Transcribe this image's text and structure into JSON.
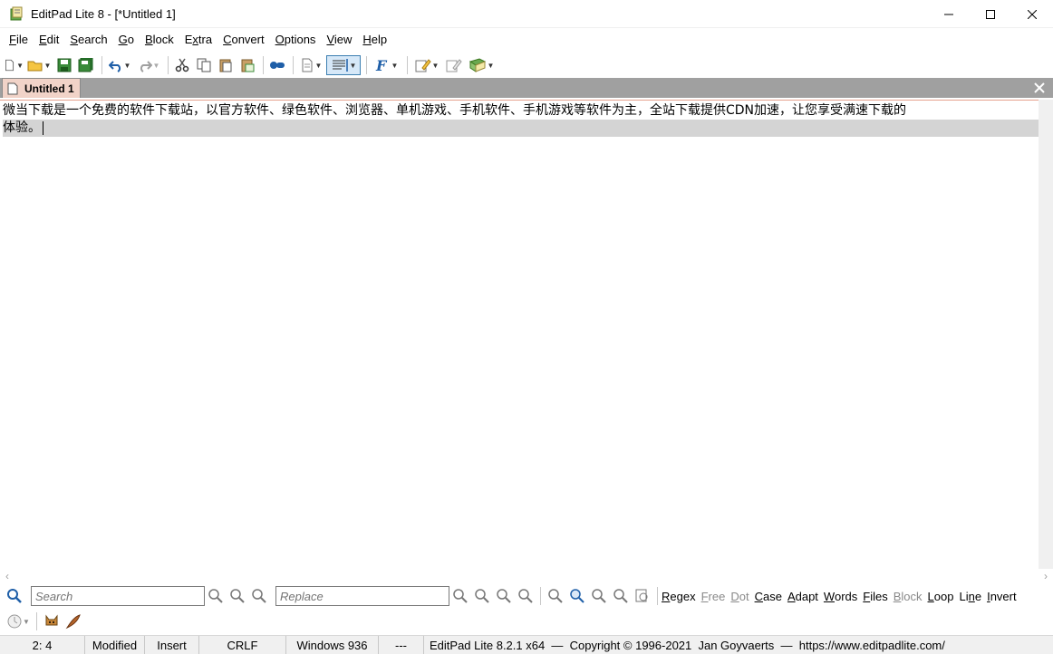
{
  "window": {
    "title": "EditPad Lite 8 - [*Untitled 1]",
    "controls": [
      "minimize",
      "maximize",
      "close"
    ]
  },
  "menu": {
    "items": [
      {
        "label": "File",
        "hotkey": "F"
      },
      {
        "label": "Edit",
        "hotkey": "E"
      },
      {
        "label": "Search",
        "hotkey": "S"
      },
      {
        "label": "Go",
        "hotkey": "G"
      },
      {
        "label": "Block",
        "hotkey": "B"
      },
      {
        "label": "Extra",
        "hotkey": "x"
      },
      {
        "label": "Convert",
        "hotkey": "C"
      },
      {
        "label": "Options",
        "hotkey": "O"
      },
      {
        "label": "View",
        "hotkey": "V"
      },
      {
        "label": "Help",
        "hotkey": "H"
      }
    ]
  },
  "toolbar": {
    "buttons": [
      "new-file-icon",
      "open-file-icon",
      "save-icon",
      "save-all-icon",
      "undo-icon",
      "redo-icon",
      "cut-icon",
      "copy-icon",
      "paste-icon",
      "paste-special-icon",
      "clipboard-icon",
      "print-icon",
      "word-wrap-icon",
      "font-icon",
      "edit-icon",
      "spellcheck-icon",
      "book-icon"
    ]
  },
  "tabs": {
    "items": [
      {
        "label": "Untitled 1",
        "active": true
      }
    ]
  },
  "editor": {
    "line1": "微当下载是一个免费的软件下载站，以官方软件、绿色软件、浏览器、单机游戏、手机软件、手机游戏等软件为主，全站下载提供CDN加速，让您享受满速下载的",
    "line2": "体验。"
  },
  "search": {
    "search_placeholder": "Search",
    "replace_placeholder": "Replace",
    "options": [
      {
        "label": "Regex",
        "hotkey": "R",
        "enabled": true
      },
      {
        "label": "Free",
        "hotkey": "F",
        "enabled": false
      },
      {
        "label": "Dot",
        "hotkey": "D",
        "enabled": false
      },
      {
        "label": "Case",
        "hotkey": "C",
        "enabled": true
      },
      {
        "label": "Adapt",
        "hotkey": "A",
        "enabled": true
      },
      {
        "label": "Words",
        "hotkey": "W",
        "enabled": true
      },
      {
        "label": "Files",
        "hotkey": "F",
        "enabled": true
      },
      {
        "label": "Block",
        "hotkey": "B",
        "enabled": false
      },
      {
        "label": "Loop",
        "hotkey": "L",
        "enabled": true
      },
      {
        "label": "Line",
        "hotkey": "n",
        "enabled": true
      },
      {
        "label": "Invert",
        "hotkey": "I",
        "enabled": true
      }
    ]
  },
  "status": {
    "position": "2: 4",
    "modified": "Modified",
    "mode": "Insert",
    "line_break": "CRLF",
    "encoding": "Windows 936",
    "extra": "---",
    "about": "EditPad Lite 8.2.1 x64  —  Copyright © 1996-2021  Jan Goyvaerts  —  https://www.editpadlite.com/"
  },
  "colors": {
    "tab_active": "#f1d3c8",
    "tabstrip_bg": "#a0a0a0",
    "current_line": "#d4d4d4",
    "accent_blue": "#1f5fa8"
  }
}
